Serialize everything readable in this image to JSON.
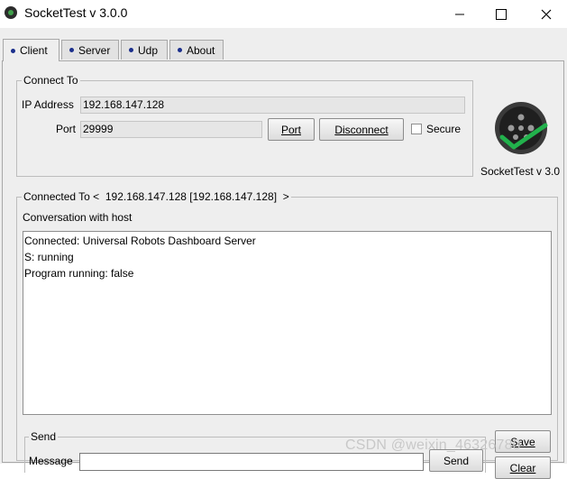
{
  "window": {
    "title": "SocketTest v 3.0.0"
  },
  "tabs": [
    {
      "label": "Client"
    },
    {
      "label": "Server"
    },
    {
      "label": "Udp"
    },
    {
      "label": "About"
    }
  ],
  "connect_to": {
    "legend": "Connect To",
    "ip_label": "IP Address",
    "ip_value": "192.168.147.128",
    "port_label": "Port",
    "port_value": "29999",
    "port_button": "Port",
    "disconnect_button": "Disconnect",
    "secure_label": "Secure",
    "secure_checked": false
  },
  "logo": {
    "caption": "SocketTest v 3.0"
  },
  "connected": {
    "legend": "Connected To <  192.168.147.128 [192.168.147.128]  >",
    "conversation_label": "Conversation with host",
    "lines": [
      "Connected: Universal Robots Dashboard Server",
      "S: running",
      "Program running: false"
    ]
  },
  "send": {
    "legend": "Send",
    "message_label": "Message",
    "message_value": "",
    "send_button": "Send"
  },
  "side_buttons": {
    "save": "Save",
    "clear": "Clear"
  },
  "watermark": "CSDN @weixin_46326780",
  "colors": {
    "tab_dot": "#1b2f8c",
    "checkmark": "#22b14c"
  }
}
